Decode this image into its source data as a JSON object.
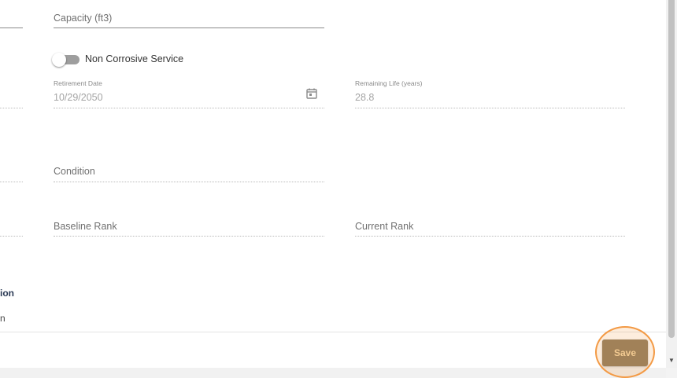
{
  "form": {
    "capacity": {
      "label": "Capacity (ft3)",
      "value": ""
    },
    "non_corrosive_service": {
      "label": "Non Corrosive Service",
      "checked": false
    },
    "retirement_date": {
      "label": "Retirement Date",
      "value": "10/29/2050",
      "icon": "calendar-icon"
    },
    "remaining_life": {
      "label": "Remaining Life (years)",
      "value": "28.8"
    },
    "condition": {
      "label": "Condition",
      "value": ""
    },
    "baseline_rank": {
      "label": "Baseline Rank",
      "value": ""
    },
    "current_rank": {
      "label": "Current Rank",
      "value": ""
    }
  },
  "left_column": {
    "section_heading_fragment": "ion",
    "section_text_fragment": "n"
  },
  "footer": {
    "save_label": "Save"
  },
  "colors": {
    "save_button_bg": "#8f7c5d",
    "save_button_text": "#f3d6a4",
    "highlight_ring": "#f39a45",
    "section_heading": "#2b3a55"
  }
}
